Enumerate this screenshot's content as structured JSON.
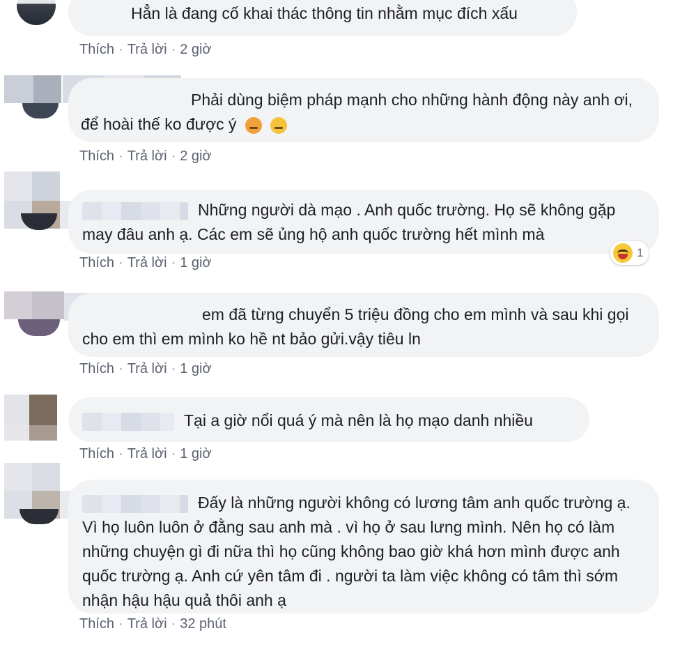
{
  "comments": [
    {
      "text": "Hẳn là đang cố khai thác thông tin nhằm mục đích xấu",
      "like": "Thích",
      "reply": "Trả lời",
      "time": "2 giờ",
      "emojis": []
    },
    {
      "text": "Phải dùng biệm pháp mạnh cho những hành động này anh ơi, để hoài thế ko được ý",
      "like": "Thích",
      "reply": "Trả lời",
      "time": "2 giờ",
      "emojis": [
        "angry-face-icon",
        "disappointed-face-icon"
      ]
    },
    {
      "text": "Những người dà mạo . Anh quốc trường. Họ sẽ không gặp may đâu anh ạ. Các em sẽ ủng hộ anh quốc trường hết mình mà",
      "like": "Thích",
      "reply": "Trả lời",
      "time": "1 giờ",
      "reaction_count": "1",
      "reaction_icon": "haha-reaction-icon"
    },
    {
      "text": "em đã từng chuyển 5 triệu đồng cho em mình và sau khi gọi cho em thì em mình ko hề nt bảo gửi.vậy tiêu ln",
      "like": "Thích",
      "reply": "Trả lời",
      "time": "1 giờ"
    },
    {
      "text": "Tại a giờ nổi quá ý mà nên là họ mạo danh nhiều",
      "like": "Thích",
      "reply": "Trả lời",
      "time": "1 giờ"
    },
    {
      "text": "Đấy là những người không có lương tâm anh quốc trường ạ. Vì họ luôn luôn ở đằng sau anh mà . vì họ ở sau lưng mình. Nên họ có làm những chuyện gì đi nữa thì họ cũng không bao giờ khá hơn mình được anh quốc trường ạ. Anh cứ yên tâm đi . người ta làm việc không có tâm thì sớm nhận hậu hậu quả thôi anh ạ",
      "like": "Thích",
      "reply": "Trả lời",
      "time": "32 phút"
    }
  ],
  "colors": {
    "bubble": "#f2f3f5",
    "action_text": "#5c6272",
    "body_text": "#1c1e21"
  }
}
